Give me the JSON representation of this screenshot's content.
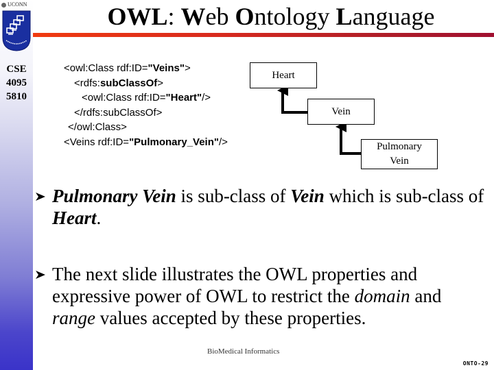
{
  "sidebar": {
    "university": "UCONN",
    "course_lines": [
      "CSE",
      "4095",
      "5810"
    ]
  },
  "title": {
    "parts": [
      {
        "text": "OWL",
        "bold": true
      },
      {
        "text": ": ",
        "bold": false
      },
      {
        "text": "W",
        "bold": true
      },
      {
        "text": "eb ",
        "bold": false
      },
      {
        "text": "O",
        "bold": true
      },
      {
        "text": "ntology ",
        "bold": false
      },
      {
        "text": "L",
        "bold": true
      },
      {
        "text": "anguage",
        "bold": false
      }
    ]
  },
  "code": {
    "lines": [
      {
        "indent": 0,
        "parts": [
          {
            "t": "<owl:Class rdf:ID=",
            "b": false
          },
          {
            "t": "\"Veins\"",
            "b": true
          },
          {
            "t": ">",
            "b": false
          }
        ]
      },
      {
        "indent": 2,
        "parts": [
          {
            "t": "<rdfs:",
            "b": false
          },
          {
            "t": "subClassOf",
            "b": true
          },
          {
            "t": ">",
            "b": false
          }
        ]
      },
      {
        "indent": 3,
        "parts": [
          {
            "t": "<owl:Class rdf:ID=",
            "b": false
          },
          {
            "t": "\"Heart\"",
            "b": true
          },
          {
            "t": "/>",
            "b": false
          }
        ]
      },
      {
        "indent": 2,
        "parts": [
          {
            "t": "</rdfs:subClassOf>",
            "b": false
          }
        ]
      },
      {
        "indent": 1,
        "parts": [
          {
            "t": "</owl:Class>",
            "b": false
          }
        ]
      },
      {
        "indent": 0,
        "parts": [
          {
            "t": "<Veins rdf:ID=",
            "b": false
          },
          {
            "t": "\"Pulmonary_Vein\"",
            "b": true
          },
          {
            "t": "/>",
            "b": false
          }
        ]
      }
    ]
  },
  "diagram": {
    "nodes": {
      "heart": "Heart",
      "vein": "Vein",
      "pulmonary_line1": "Pulmonary",
      "pulmonary_line2": "Vein"
    },
    "edges": [
      {
        "from": "Vein",
        "to": "Heart",
        "relation": "subClassOf"
      },
      {
        "from": "Pulmonary Vein",
        "to": "Vein",
        "relation": "subClassOf"
      }
    ]
  },
  "bullets": [
    {
      "segments": [
        {
          "t": "Pulmonary Vein",
          "style": "bold-italic"
        },
        {
          "t": " is sub-class of ",
          "style": "normal"
        },
        {
          "t": "Vein",
          "style": "bold-italic"
        },
        {
          "t": "  which is sub-class of ",
          "style": "normal"
        },
        {
          "t": "Heart",
          "style": "bold-italic"
        },
        {
          "t": ".",
          "style": "normal"
        }
      ]
    },
    {
      "segments": [
        {
          "t": "The next slide illustrates the OWL properties and expressive power of OWL to restrict the ",
          "style": "normal"
        },
        {
          "t": "domain",
          "style": "italic"
        },
        {
          "t": " and ",
          "style": "normal"
        },
        {
          "t": "range",
          "style": "italic"
        },
        {
          "t": " values accepted by these properties.",
          "style": "normal"
        }
      ]
    }
  ],
  "footer": {
    "text": "BioMedical Informatics",
    "slide_id": "ONTO-29"
  },
  "colors": {
    "title_rule_start": "#f03a10",
    "title_rule_end": "#a01030",
    "sidebar_bottom": "#3a33c9",
    "logo_blue": "#1a2fa0"
  }
}
